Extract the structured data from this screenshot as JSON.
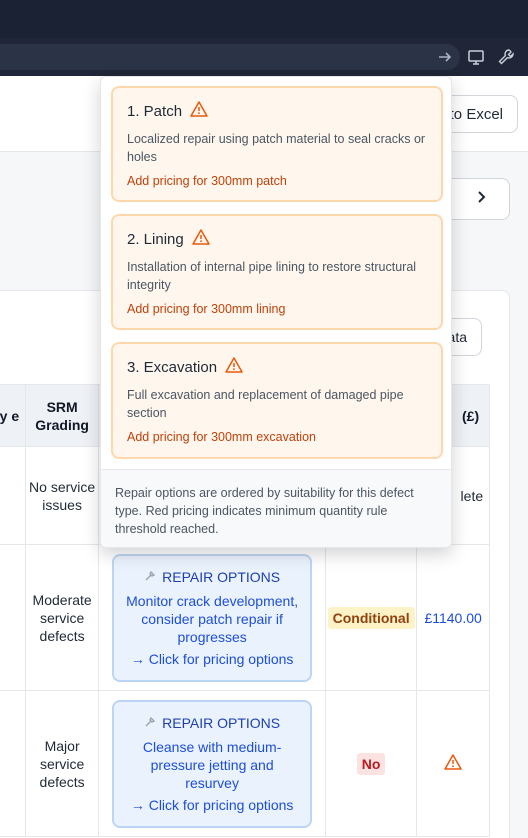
{
  "toolbar": {
    "export_label": "to Excel",
    "data_label": "ata"
  },
  "table": {
    "headers": [
      "ty e",
      "SRM Grading",
      "",
      "",
      "(£)"
    ],
    "rows": [
      {
        "grading": "No service issues",
        "right": "lete"
      },
      {
        "grading": "Moderate service defects",
        "repair_title": "REPAIR OPTIONS",
        "repair_desc": "Monitor crack development, consider patch repair if progresses",
        "repair_link": "→ Click for pricing options",
        "badge": "Conditional",
        "price": "£1140.00"
      },
      {
        "grading": "Major service defects",
        "repair_title": "REPAIR OPTIONS",
        "repair_desc": "Cleanse with medium-pressure jetting and resurvey",
        "repair_link": "→ Click for pricing options",
        "badge": "No"
      }
    ]
  },
  "popover": {
    "options": [
      {
        "title": "1. Patch",
        "desc": "Localized repair using patch material to seal cracks or holes",
        "link": "Add pricing for 300mm patch"
      },
      {
        "title": "2. Lining",
        "desc": "Installation of internal pipe lining to restore structural integrity",
        "link": "Add pricing for 300mm lining"
      },
      {
        "title": "3. Excavation",
        "desc": "Full excavation and replacement of damaged pipe section",
        "link": "Add pricing for 300mm excavation"
      }
    ],
    "footer": "Repair options are ordered by suitability for this defect type. Red pricing indicates minimum quantity rule threshold reached."
  },
  "icons": [
    "arrow-right-icon",
    "monitor-icon",
    "wrench-icon",
    "menu-icon",
    "chevron-right-icon",
    "warning-icon",
    "repair-tool-icon"
  ],
  "colors": {
    "warning": "#ea580c",
    "option_bg": "#fff7ed",
    "option_border": "#fed7aa",
    "repair_bg": "#eaf2fd",
    "link_blue": "#1d4ed8"
  }
}
